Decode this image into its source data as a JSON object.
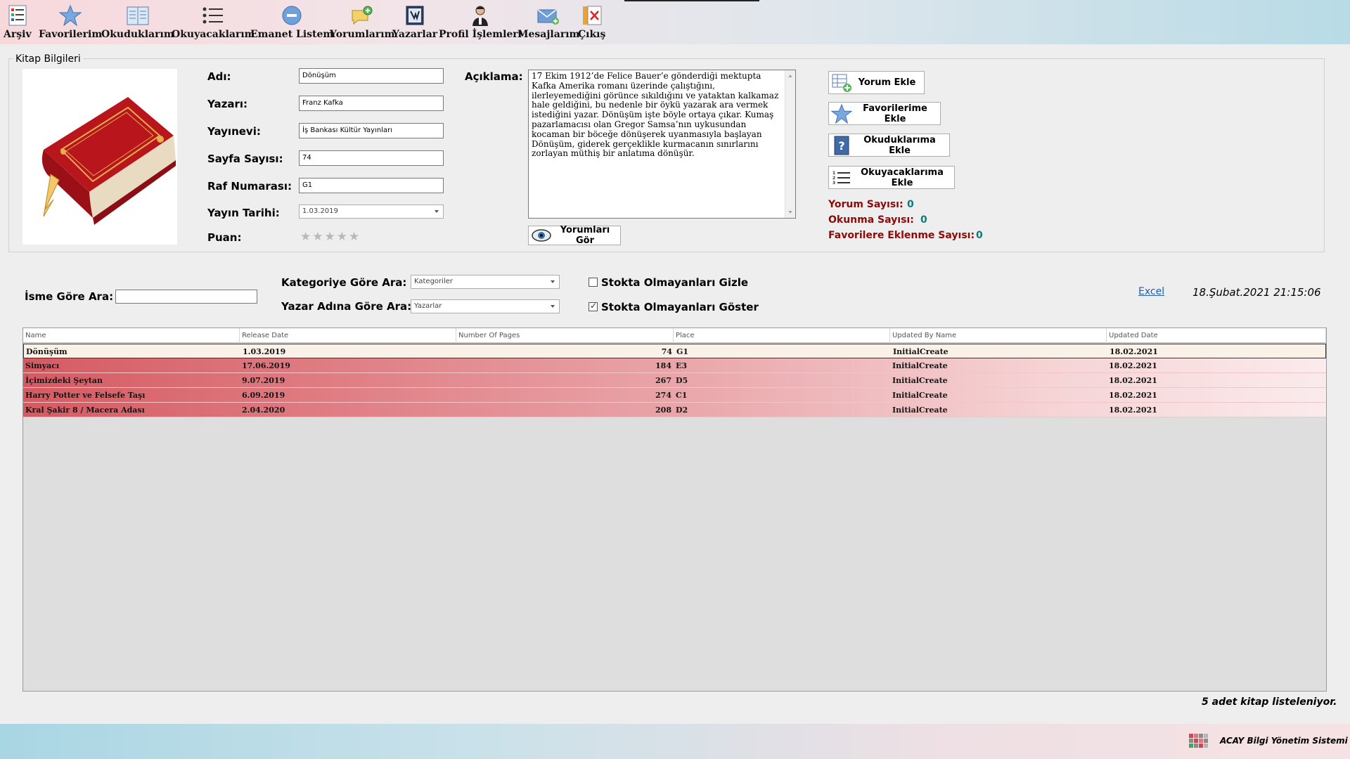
{
  "toolbar": {
    "items": [
      {
        "label": "Arşiv",
        "icon": "list-icon"
      },
      {
        "label": "Favorilerim",
        "icon": "star-icon"
      },
      {
        "label": "Okuduklarım",
        "icon": "book-open-icon"
      },
      {
        "label": "Okuyacaklarım",
        "icon": "numbered-list-icon"
      },
      {
        "label": "Emanet Listem",
        "icon": "minus-circle-icon"
      },
      {
        "label": "Yorumlarım",
        "icon": "comment-add-icon"
      },
      {
        "label": "Yazarlar",
        "icon": "writer-icon"
      },
      {
        "label": "Profil İşlemleri",
        "icon": "user-icon"
      },
      {
        "label": "Mesajlarım",
        "icon": "mail-add-icon"
      },
      {
        "label": "Çıkış",
        "icon": "exit-icon"
      }
    ]
  },
  "book_info": {
    "title": "Kitap Bilgileri",
    "fields": {
      "name_label": "Adı:",
      "name_value": "Dönüşüm",
      "author_label": "Yazarı:",
      "author_value": "Franz Kafka",
      "publisher_label": "Yayınevi:",
      "publisher_value": "İş Bankası Kültür Yayınları",
      "pages_label": "Sayfa Sayısı:",
      "pages_value": "74",
      "shelf_label": "Raf Numarası:",
      "shelf_value": "G1",
      "date_label": "Yayın Tarihi:",
      "date_value": "1.03.2019",
      "rating_label": "Puan:",
      "rating_value": 0,
      "rating_max": 5
    },
    "description_label": "Açıklama:",
    "description": "17 Ekim 1912’de Felice Bauer’e gönderdiği mektupta Kafka Amerika romanı üzerinde çalıştığını, ilerleyemediğini görünce sıkıldığını ve yataktan kalkamaz hale geldiğini, bu nedenle bir öykü yazarak ara vermek istediğini yazar. Dönüşüm işte böyle ortaya çıkar. Kumaş pazarlamacısı olan Gregor Samsa’nın uykusundan kocaman bir böceğe dönüşerek uyanmasıyla başlayan Dönüşüm, giderek gerçeklikle kurmacanın sınırlarını zorlayan müthiş bir anlatıma dönüşür.",
    "view_comments_button": "Yorumları Gör",
    "buttons": {
      "add_comment": "Yorum Ekle",
      "add_favorite": "Favorilerime Ekle",
      "add_read": "Okuduklarıma Ekle",
      "add_to_read": "Okuyacaklarıma Ekle"
    },
    "stats": {
      "comment_count_label": "Yorum Sayısı:",
      "comment_count": "0",
      "read_count_label": "Okunma Sayısı:",
      "read_count": "0",
      "favorite_count_label": "Favorilere Eklenme Sayısı:",
      "favorite_count": "0"
    }
  },
  "search": {
    "name_label": "İsme Göre Ara:",
    "name_value": "",
    "category_label": "Kategoriye Göre Ara:",
    "category_value": "Kategoriler",
    "author_label": "Yazar Adına Göre Ara:",
    "author_value": "Yazarlar",
    "hide_out_of_stock_label": "Stokta Olmayanları Gizle",
    "hide_out_of_stock_checked": false,
    "show_out_of_stock_label": "Stokta Olmayanları Göster",
    "show_out_of_stock_checked": true,
    "excel_link": "Excel",
    "datetime": "18.Şubat.2021 21:15:06"
  },
  "grid": {
    "columns": [
      "Name",
      "Release Date",
      "Number Of Pages",
      "Place",
      "Updated By Name",
      "Updated Date"
    ],
    "rows": [
      [
        "Dönüşüm",
        "1.03.2019",
        "74",
        "G1",
        "InitialCreate",
        "18.02.2021"
      ],
      [
        "Simyacı",
        "17.06.2019",
        "184",
        "E3",
        "InitialCreate",
        "18.02.2021"
      ],
      [
        "İçimizdeki Şeytan",
        "9.07.2019",
        "267",
        "D5",
        "InitialCreate",
        "18.02.2021"
      ],
      [
        "Harry Potter ve Felsefe Taşı",
        "6.09.2019",
        "274",
        "C1",
        "InitialCreate",
        "18.02.2021"
      ],
      [
        "Kral Şakir 8 / Macera Adası",
        "2.04.2020",
        "208",
        "D2",
        "InitialCreate",
        "18.02.2021"
      ]
    ],
    "selected_row": 0
  },
  "footer": {
    "list_count": "5 adet kitap listeleniyor.",
    "brand": "ACAY Bilgi Yönetim Sistemi"
  },
  "colors": {
    "stat_label": "#8b0a0a",
    "stat_value": "#0e7a7a",
    "row_highlight": "#d65a62",
    "link": "#1f5ea8"
  }
}
